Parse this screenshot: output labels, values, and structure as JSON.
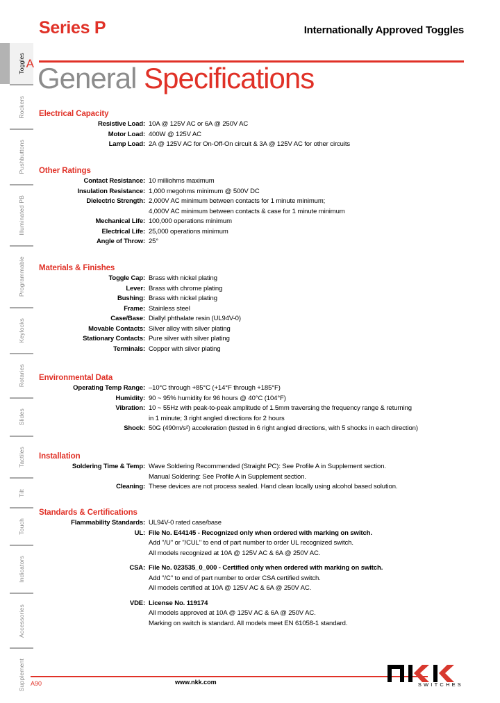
{
  "header": {
    "series_title": "Series P",
    "subtitle": "Internationally Approved Toggles",
    "page_title_grey": "General",
    "page_title_red": "Specifications"
  },
  "sidebar": {
    "active_letter": "A",
    "items": [
      {
        "label": "Toggles",
        "active": true
      },
      {
        "label": "Rockers",
        "active": false
      },
      {
        "label": "Pushbuttons",
        "active": false
      },
      {
        "label": "Illuminated PB",
        "active": false
      },
      {
        "label": "Programmable",
        "active": false
      },
      {
        "label": "Keylocks",
        "active": false
      },
      {
        "label": "Rotaries",
        "active": false
      },
      {
        "label": "Slides",
        "active": false
      },
      {
        "label": "Tactiles",
        "active": false
      },
      {
        "label": "Tilt",
        "active": false
      },
      {
        "label": "Touch",
        "active": false
      },
      {
        "label": "Indicators",
        "active": false
      },
      {
        "label": "Accessories",
        "active": false
      },
      {
        "label": "Supplement",
        "active": false
      }
    ]
  },
  "sections": {
    "electrical_capacity": {
      "heading": "Electrical Capacity",
      "rows": [
        {
          "label": "Resistive Load:",
          "value": "10A @ 125V AC or 6A @ 250V AC"
        },
        {
          "label": "Motor Load:",
          "value": "400W @ 125V AC"
        },
        {
          "label": "Lamp Load:",
          "value": "2A @ 125V AC for On-Off-On circuit & 3A @ 125V AC for other circuits"
        }
      ]
    },
    "other_ratings": {
      "heading": "Other Ratings",
      "rows": [
        {
          "label": "Contact Resistance:",
          "value": "10 milliohms maximum"
        },
        {
          "label": "Insulation Resistance:",
          "value": "1,000 megohms minimum @ 500V DC"
        },
        {
          "label": "Dielectric Strength:",
          "value": "2,000V AC minimum between contacts for 1 minute minimum;"
        },
        {
          "label": "",
          "value": "4,000V AC minimum between contacts & case for 1 minute minimum"
        },
        {
          "label": "Mechanical Life:",
          "value": "100,000 operations minimum"
        },
        {
          "label": "Electrical Life:",
          "value": "25,000 operations minimum"
        },
        {
          "label": "Angle of Throw:",
          "value": "25°"
        }
      ]
    },
    "materials_finishes": {
      "heading": "Materials & Finishes",
      "rows": [
        {
          "label": "Toggle Cap:",
          "value": "Brass with nickel plating"
        },
        {
          "label": "Lever:",
          "value": "Brass with chrome plating"
        },
        {
          "label": "Bushing:",
          "value": "Brass with nickel plating"
        },
        {
          "label": "Frame:",
          "value": "Stainless steel"
        },
        {
          "label": "Case/Base:",
          "value": "Diallyl phthalate resin (UL94V-0)"
        },
        {
          "label": "Movable Contacts:",
          "value": "Silver alloy with silver plating"
        },
        {
          "label": "Stationary Contacts:",
          "value": "Pure silver with silver plating"
        },
        {
          "label": "Terminals:",
          "value": "Copper with silver plating"
        }
      ]
    },
    "environmental_data": {
      "heading": "Environmental Data",
      "rows": [
        {
          "label": "Operating Temp Range:",
          "value": "–10°C through +85°C (+14°F through +185°F)"
        },
        {
          "label": "Humidity:",
          "value": "90 ~ 95% humidity for 96 hours @ 40°C (104°F)"
        },
        {
          "label": "Vibration:",
          "value": "10 ~ 55Hz with peak-to-peak amplitude of 1.5mm traversing the frequency range & returning"
        },
        {
          "label": "",
          "value": "in 1 minute; 3 right angled directions for 2 hours"
        },
        {
          "label": "Shock:",
          "value": "50G (490m/s²) acceleration (tested in 6 right angled directions, with 5 shocks in each direction)"
        }
      ]
    },
    "installation": {
      "heading": "Installation",
      "rows": [
        {
          "label": "Soldering Time & Temp:",
          "value": "Wave Soldering Recommended (Straight PC):  See Profile A in Supplement section."
        },
        {
          "label": "",
          "value": "Manual Soldering:  See Profile A in Supplement section."
        },
        {
          "label": "Cleaning:",
          "value": "These devices are not process sealed.  Hand clean locally using alcohol based solution."
        }
      ]
    },
    "standards_certifications": {
      "heading": "Standards & Certifications",
      "rows": [
        {
          "label": "Flammability Standards:",
          "value": "UL94V-0 rated case/base",
          "bold": false
        },
        {
          "label": "UL:",
          "value": "File No. E44145 - Recognized only when ordered with marking on switch.",
          "bold": true
        },
        {
          "label": "",
          "value": "Add \"/U\" or \"/CUL\" to end of part number to order UL recognized switch.",
          "bold": false
        },
        {
          "label": "",
          "value": "All models recognized at 10A @ 125V AC & 6A @ 250V AC.",
          "bold": false
        },
        {
          "label": "",
          "value": "",
          "bold": false,
          "spacer": true
        },
        {
          "label": "CSA:",
          "value": "File No. 023535_0_000 - Certified only when ordered with marking on switch.",
          "bold": true
        },
        {
          "label": "",
          "value": "Add \"/C\" to end of part number to order CSA certified switch.",
          "bold": false
        },
        {
          "label": "",
          "value": "All models certified at 10A @ 125V AC & 6A @ 250V AC.",
          "bold": false
        },
        {
          "label": "",
          "value": "",
          "bold": false,
          "spacer": true
        },
        {
          "label": "VDE:",
          "value": "License No. 119174",
          "bold": true
        },
        {
          "label": "",
          "value": "All models approved at 10A @ 125V AC & 6A @ 250V AC.",
          "bold": false
        },
        {
          "label": "",
          "value": "Marking on switch is standard.  All models meet EN 61058-1 standard.",
          "bold": false
        }
      ]
    }
  },
  "footer": {
    "page_number": "A90",
    "url": "www.nkk.com",
    "logo_text": "nkk",
    "logo_subtext": "SWITCHES"
  },
  "colors": {
    "brand_red": "#e03127",
    "title_grey": "#8c8c8c",
    "rail_grey": "#a8a8a8"
  }
}
